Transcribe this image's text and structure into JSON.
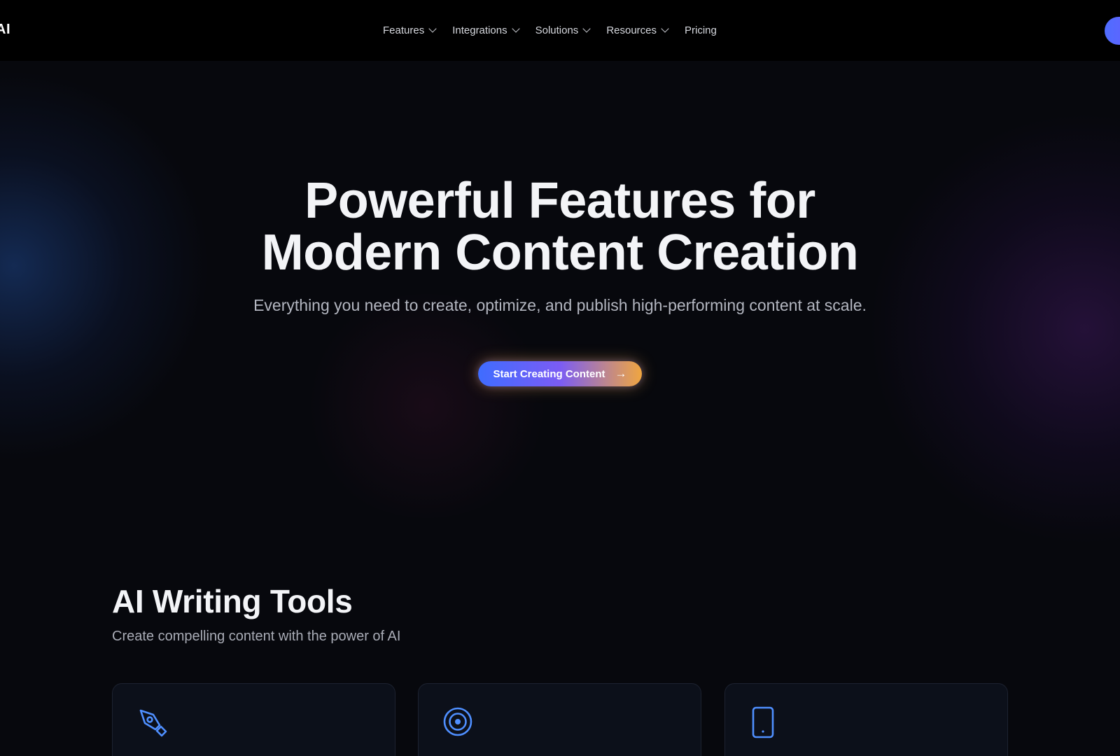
{
  "brand": {
    "logo_text": "AI"
  },
  "nav": {
    "items": [
      {
        "label": "Features",
        "has_dropdown": true
      },
      {
        "label": "Integrations",
        "has_dropdown": true
      },
      {
        "label": "Solutions",
        "has_dropdown": true
      },
      {
        "label": "Resources",
        "has_dropdown": true
      },
      {
        "label": "Pricing",
        "has_dropdown": false
      }
    ]
  },
  "hero": {
    "title_line1": "Powerful Features for",
    "title_line2": "Modern Content Creation",
    "subtitle": "Everything you need to create, optimize, and publish high-performing content at scale.",
    "cta_label": "Start Creating Content",
    "cta_arrow": "→"
  },
  "section": {
    "title": "AI Writing Tools",
    "subtitle": "Create compelling content with the power of AI"
  },
  "cards": [
    {
      "icon": "pen-icon"
    },
    {
      "icon": "target-icon"
    },
    {
      "icon": "tablet-icon"
    }
  ],
  "colors": {
    "background": "#07080d",
    "navbar": "#000000",
    "accent_blue": "#3f6cff",
    "accent_purple": "#7b5cf4",
    "accent_orange": "#f0a640",
    "icon_blue": "#4f8fff"
  }
}
